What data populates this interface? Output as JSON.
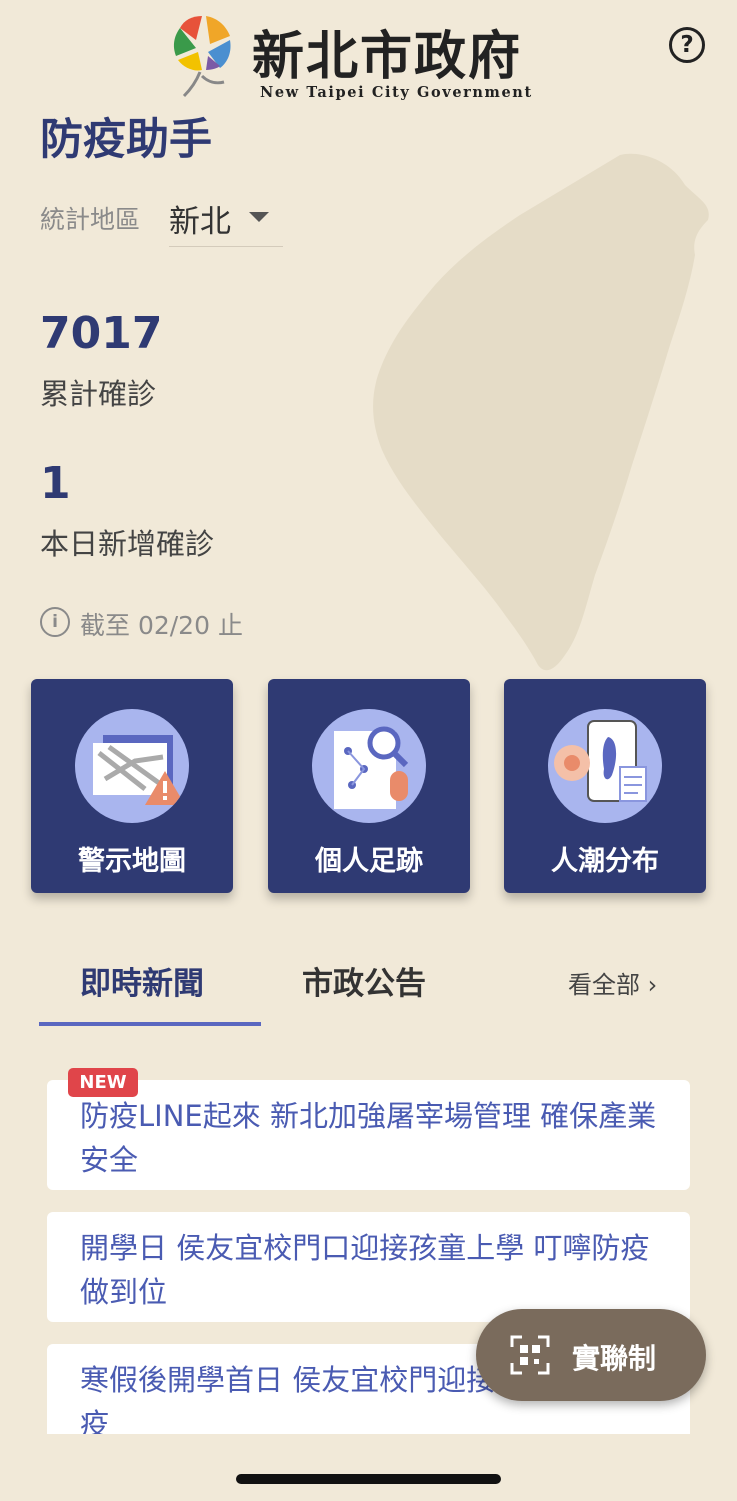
{
  "header": {
    "logo_title": "新北市政府",
    "logo_subtitle": "New Taipei City Government",
    "help_label": "?"
  },
  "page_title": "防疫助手",
  "region": {
    "label": "統計地區",
    "value": "新北"
  },
  "stats": {
    "total_value": "7017",
    "total_label": "累計確診",
    "today_value": "1",
    "today_label": "本日新增確診",
    "as_of": "截至 02/20 止"
  },
  "cards": [
    {
      "label": "警示地圖",
      "icon": "warning-map-icon"
    },
    {
      "label": "個人足跡",
      "icon": "footprint-search-icon"
    },
    {
      "label": "人潮分布",
      "icon": "crowd-distribution-icon"
    }
  ],
  "tabs": [
    {
      "label": "即時新聞",
      "active": true
    },
    {
      "label": "市政公告",
      "active": false
    }
  ],
  "see_all": "看全部 ›",
  "news": [
    {
      "badge": "NEW",
      "title": "防疫LINE起來 新北加強屠宰場管理 確保產業安全"
    },
    {
      "title": "開學日 侯友宜校門口迎接孩童上學 叮嚀防疫做到位"
    },
    {
      "title": "寒假後開學首日 侯友宜校門迎接 提醒落實防疫"
    }
  ],
  "fab": {
    "label": "實聯制",
    "icon": "qr-scan-icon"
  },
  "colors": {
    "background": "#f1e9d8",
    "primary": "#2f3a73",
    "link": "#4a5bb2",
    "badge": "#e0454a",
    "fab": "#7a6b5c"
  }
}
